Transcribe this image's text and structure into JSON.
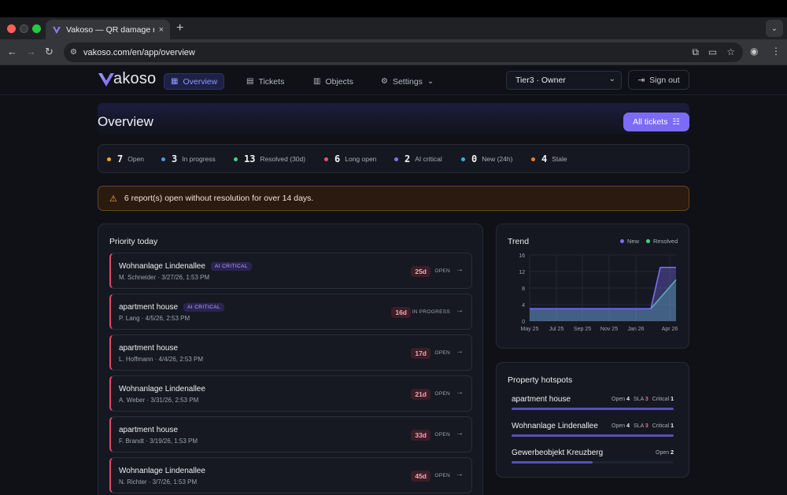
{
  "browser": {
    "tab_title": "Vakoso — QR damage reporting",
    "tab_close": "×",
    "new_tab": "+",
    "url": "vakoso.com/en/app/overview"
  },
  "nav": {
    "logo": "akoso",
    "items": [
      {
        "label": "Overview",
        "icon": "grid-icon"
      },
      {
        "label": "Tickets",
        "icon": "clipboard-icon"
      },
      {
        "label": "Objects",
        "icon": "building-icon"
      },
      {
        "label": "Settings",
        "icon": "gear-icon"
      }
    ],
    "role": "Tier3 · Owner",
    "sign_out": "Sign out"
  },
  "page": {
    "title": "Overview",
    "all_tickets": "All tickets"
  },
  "stats": [
    {
      "num": "7",
      "label": "Open",
      "color": "#f5a623"
    },
    {
      "num": "3",
      "label": "In progress",
      "color": "#3d9cf0"
    },
    {
      "num": "13",
      "label": "Resolved (30d)",
      "color": "#3dd68c"
    },
    {
      "num": "6",
      "label": "Long open",
      "color": "#f0506e"
    },
    {
      "num": "2",
      "label": "AI critical",
      "color": "#8b6cf7"
    },
    {
      "num": "0",
      "label": "New (24h)",
      "color": "#29b6e8"
    },
    {
      "num": "4",
      "label": "Stale",
      "color": "#f57c23"
    }
  ],
  "alert": "6 report(s) open without resolution for over 14 days.",
  "priority": {
    "title": "Priority today",
    "rows": [
      {
        "object": "Wohnanlage Lindenallee",
        "ai": "AI CRITICAL",
        "person": "M. Schneider",
        "date": "3/27/26, 1:53 PM",
        "age": "25d",
        "status": "OPEN"
      },
      {
        "object": "apartment house",
        "ai": "AI CRITICAL",
        "person": "P. Lang",
        "date": "4/5/26, 2:53 PM",
        "age": "16d",
        "status": "IN PROGRESS"
      },
      {
        "object": "apartment house",
        "ai": "",
        "person": "L. Hoffmann",
        "date": "4/4/26, 2:53 PM",
        "age": "17d",
        "status": "OPEN"
      },
      {
        "object": "Wohnanlage Lindenallee",
        "ai": "",
        "person": "A. Weber",
        "date": "3/31/26, 2:53 PM",
        "age": "21d",
        "status": "OPEN"
      },
      {
        "object": "apartment house",
        "ai": "",
        "person": "F. Brandt",
        "date": "3/19/26, 1:53 PM",
        "age": "33d",
        "status": "OPEN"
      },
      {
        "object": "Wohnanlage Lindenallee",
        "ai": "",
        "person": "N. Richter",
        "date": "3/7/26, 1:53 PM",
        "age": "45d",
        "status": "OPEN"
      }
    ]
  },
  "chart_data": {
    "type": "area",
    "title": "Trend",
    "x": [
      "May 25",
      "Jul 25",
      "Sep 25",
      "Nov 25",
      "Jan 26",
      "Apr 26"
    ],
    "ylim": [
      0,
      16
    ],
    "yticks": [
      "16",
      "12",
      "8",
      "4",
      "0"
    ],
    "legend_position": "top-right",
    "series": [
      {
        "name": "New",
        "color": "#7b6cf5",
        "values": [
          3,
          3,
          3,
          3,
          3,
          13
        ]
      },
      {
        "name": "Resolved",
        "color": "#3dd68c",
        "values": [
          3,
          3,
          3,
          3,
          3,
          10
        ]
      }
    ]
  },
  "hotspots": {
    "title": "Property hotspots",
    "items": [
      {
        "name": "apartment house",
        "open_label": "Open",
        "open": "4",
        "sla_label": "SLA",
        "sla": "3",
        "critical_label": "Critical",
        "critical": "1",
        "share": 1.0
      },
      {
        "name": "Wohnanlage Lindenallee",
        "open_label": "Open",
        "open": "4",
        "sla_label": "SLA",
        "sla": "3",
        "critical_label": "Critical",
        "critical": "1",
        "share": 1.0
      },
      {
        "name": "Gewerbeobjekt Kreuzberg",
        "open_label": "Open",
        "open": "2",
        "share": 0.5
      }
    ]
  }
}
